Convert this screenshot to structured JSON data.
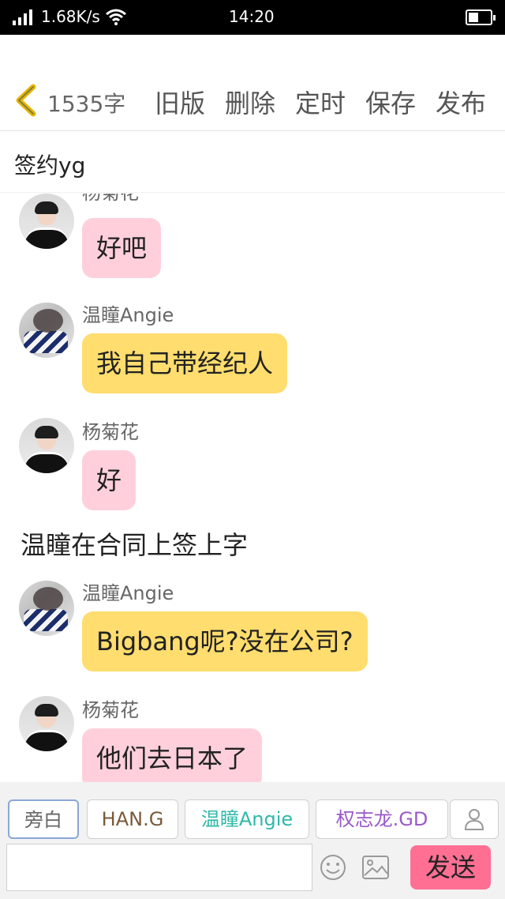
{
  "status_bar": {
    "speed": "1.68K/s",
    "time": "14:20"
  },
  "toolbar": {
    "word_count": "1535字",
    "old_version": "旧版",
    "delete": "删除",
    "schedule": "定时",
    "save": "保存",
    "publish": "发布"
  },
  "title": "签约yg",
  "messages": [
    {
      "type": "chat",
      "name": "杨菊花",
      "text": "好吧",
      "bubble_color": "#ffd0dc"
    },
    {
      "type": "chat",
      "name": "温瞳Angie",
      "text": "我自己带经纪人",
      "bubble_color": "#ffdd6e"
    },
    {
      "type": "chat",
      "name": "杨菊花",
      "text": "好",
      "bubble_color": "#ffd0dc"
    },
    {
      "type": "narration",
      "text": "温瞳在合同上签上字"
    },
    {
      "type": "chat",
      "name": "温瞳Angie",
      "text": "Bigbang呢?没在公司?",
      "bubble_color": "#ffdd6e"
    },
    {
      "type": "chat",
      "name": "杨菊花",
      "text": "他们去日本了",
      "bubble_color": "#ffd0dc"
    }
  ],
  "characters": {
    "narrator": "旁白",
    "han_g": "HAN.G",
    "angie": "温瞳Angie",
    "gd": "权志龙.GD",
    "colors": {
      "han_g": "#7a5a3a",
      "angie": "#2fb9a8",
      "gd": "#9b59c9"
    }
  },
  "input": {
    "placeholder": ""
  },
  "send_label": "发送",
  "colors": {
    "pink_bubble": "#ffd0dc",
    "yellow_bubble": "#ffdd6e",
    "send_button": "#ff6f94",
    "back_arrow": "#e5b800"
  }
}
